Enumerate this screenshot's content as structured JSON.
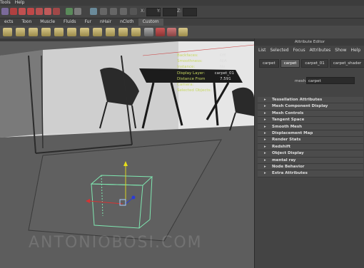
{
  "menubar": [
    "Tools",
    "Help"
  ],
  "statusline": {
    "x_label": "X:",
    "y_label": "Y:",
    "z_label": "Z:"
  },
  "shelf_tabs": [
    "ects",
    "Toon",
    "Muscle",
    "Fluids",
    "Fur",
    "nHair",
    "nCloth",
    "Custom"
  ],
  "hud": [
    {
      "key": "Backfaces:",
      "value": "Off"
    },
    {
      "key": "Smoothness:",
      "value": "N/A"
    },
    {
      "key": "Instance:",
      "value": "No"
    },
    {
      "key": "Display Layer:",
      "value": "carpet_01"
    },
    {
      "key": "Distance From Camera:",
      "value": "7.591"
    },
    {
      "key": "Selected Objects:",
      "value": "1"
    }
  ],
  "watermark": "ANTONIOBOSI.COM",
  "attribute_editor": {
    "title": "Attribute Editor",
    "menu": [
      "List",
      "Selected",
      "Focus",
      "Attributes",
      "Show",
      "Help"
    ],
    "tabs": [
      "carpet",
      "carpet",
      "carpet_01",
      "carpet_shader"
    ],
    "active_tab": 1,
    "mesh_label": "mesh:",
    "mesh_value": "carpet",
    "sections": [
      "Tessellation Attributes",
      "Mesh Component Display",
      "Mesh Controls",
      "Tangent Space",
      "Smooth Mesh",
      "Displacement Map",
      "Render Stats",
      "Redshift",
      "Object Display",
      "mental ray",
      "Node Behavior",
      "Extra Attributes"
    ]
  }
}
